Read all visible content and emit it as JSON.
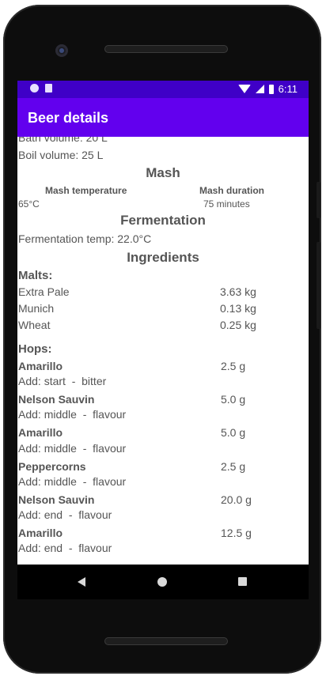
{
  "status_bar": {
    "time": "6:11"
  },
  "app_bar": {
    "title": "Beer details"
  },
  "details": {
    "bath_volume": "Bath volume: 20 L",
    "boil_volume": "Boil volume: 25 L",
    "mash": {
      "title": "Mash",
      "temp_header": "Mash temperature",
      "duration_header": "Mash duration",
      "temp_value": "65°C",
      "duration_value": "75 minutes"
    },
    "fermentation": {
      "title": "Fermentation",
      "temp": "Fermentation temp: 22.0°C"
    },
    "ingredients": {
      "title": "Ingredients",
      "malts_header": "Malts:",
      "malts": [
        {
          "name": "Extra Pale",
          "amount": "3.63 kg"
        },
        {
          "name": "Munich",
          "amount": "0.13 kg"
        },
        {
          "name": "Wheat",
          "amount": "0.25 kg"
        }
      ],
      "hops_header": "Hops:",
      "hops": [
        {
          "name": "Amarillo",
          "amount": "2.5 g",
          "add": "Add: start  -  bitter"
        },
        {
          "name": "Nelson Sauvin",
          "amount": "5.0 g",
          "add": "Add: middle  -  flavour"
        },
        {
          "name": "Amarillo",
          "amount": "5.0 g",
          "add": "Add: middle  -  flavour"
        },
        {
          "name": "Peppercorns",
          "amount": "2.5 g",
          "add": "Add: middle  -  flavour"
        },
        {
          "name": "Nelson Sauvin",
          "amount": "20.0 g",
          "add": "Add: end  -  flavour"
        },
        {
          "name": "Amarillo",
          "amount": "12.5 g",
          "add": "Add: end  -  flavour"
        }
      ]
    }
  },
  "nav_bar": {
    "back": "back-icon",
    "home": "home-icon",
    "recents": "recents-icon"
  },
  "colors": {
    "status_bar": "#3f00c7",
    "app_bar": "#6200ee",
    "text": "#555555"
  }
}
